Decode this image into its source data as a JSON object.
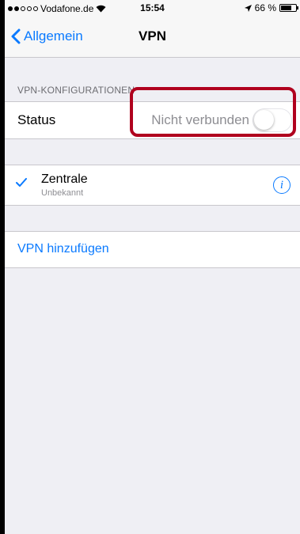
{
  "status_bar": {
    "signal_full": 2,
    "signal_total": 5,
    "carrier": "Vodafone.de",
    "time": "15:54",
    "battery_text": "66 %",
    "battery_level": 0.66
  },
  "nav": {
    "back_label": "Allgemein",
    "title": "VPN"
  },
  "section": {
    "header": "VPN-KONFIGURATIONEN"
  },
  "status_row": {
    "label": "Status",
    "value": "Nicht verbunden",
    "toggle_on": false
  },
  "config": {
    "name": "Zentrale",
    "subtitle": "Unbekannt",
    "selected": true
  },
  "add_vpn": {
    "label": "VPN hinzufügen"
  },
  "colors": {
    "accent": "#0a7aff",
    "highlight": "#b0001e",
    "background": "#efeff4"
  }
}
